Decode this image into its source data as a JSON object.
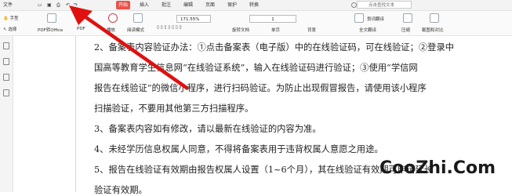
{
  "menubar": {
    "items": [
      "文件",
      "开始",
      "插入",
      "批注",
      "编辑",
      "页面",
      "保护",
      "转换"
    ],
    "search_placeholder": "点击查找文本"
  },
  "toolbar": {
    "hand_label": "手型",
    "select_label": "选择",
    "pdf_to_office": "PDF转Office",
    "pdf_to": "PDF",
    "play_label": "播放",
    "read_mode": "阅读模式",
    "zoom_value": "171.55%",
    "page_value": "1",
    "rotate_label": "旋转文档",
    "single_label": "单页",
    "bg_label": "背景",
    "translate_label": "划词翻译",
    "full_translate": "全文翻译",
    "compress_label": "压缩",
    "screenshot_label": "截图和对比"
  },
  "document": {
    "lines": [
      "2、备案表内容验证办法：①点击备案表（电子版）中的在线验证码，可在线验证；②登录中",
      "国高等教育学生信息网“在线验证系统”，输入在线验证码进行验证；③使用“学信网",
      "报告在线验证”的微信小程序，进行扫码验证。为防止出现假冒报告，请使用该小程序",
      "扫描验证，不要用其他第三方扫描程序。",
      "3、备案表内容如有修改，请以最新在线验证的内容为准。",
      "4、未经学历信息权属人同意，不得将备案表用于违背权属人意愿之用途。",
      "5、报告在线验证有效期由报告权属人设置（1~6个月），其在线验证有效期可申请延长",
      "验证有效期。"
    ]
  },
  "watermark": "CooZhi.Com",
  "colors": {
    "arrow": "#e01010",
    "accent": "#e8524a"
  }
}
